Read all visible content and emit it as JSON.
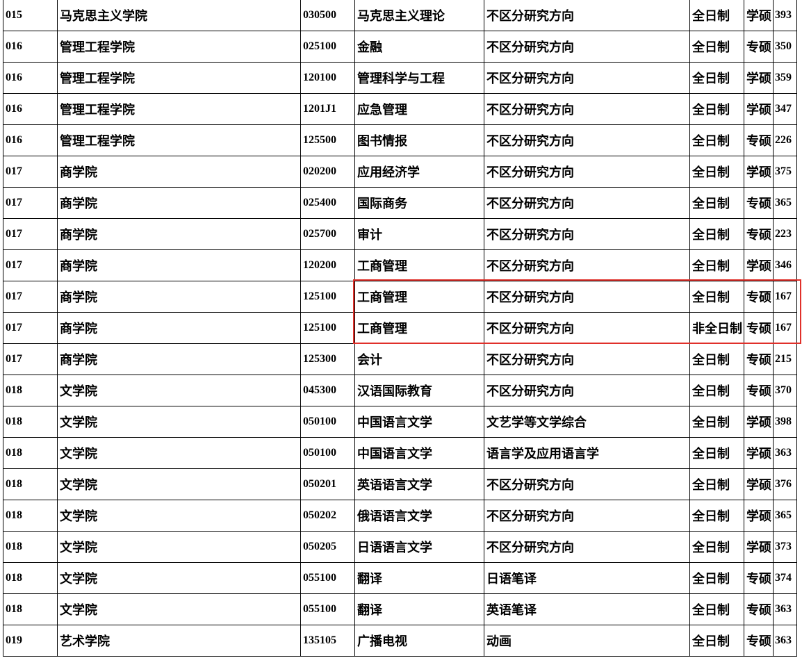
{
  "highlight_color": "#e0302a",
  "rows": [
    {
      "dept_code": "015",
      "dept_name": "马克思主义学院",
      "major_code": "030500",
      "major_name": "马克思主义理论",
      "direction": "不区分研究方向",
      "study_mode": "全日制",
      "degree_type": "学硕",
      "score": "393"
    },
    {
      "dept_code": "016",
      "dept_name": "管理工程学院",
      "major_code": "025100",
      "major_name": "金融",
      "direction": "不区分研究方向",
      "study_mode": "全日制",
      "degree_type": "专硕",
      "score": "350"
    },
    {
      "dept_code": "016",
      "dept_name": "管理工程学院",
      "major_code": "120100",
      "major_name": "管理科学与工程",
      "direction": "不区分研究方向",
      "study_mode": "全日制",
      "degree_type": "学硕",
      "score": "359"
    },
    {
      "dept_code": "016",
      "dept_name": "管理工程学院",
      "major_code": "1201J1",
      "major_name": "应急管理",
      "direction": "不区分研究方向",
      "study_mode": "全日制",
      "degree_type": "学硕",
      "score": "347"
    },
    {
      "dept_code": "016",
      "dept_name": "管理工程学院",
      "major_code": "125500",
      "major_name": "图书情报",
      "direction": "不区分研究方向",
      "study_mode": "全日制",
      "degree_type": "专硕",
      "score": "226"
    },
    {
      "dept_code": "017",
      "dept_name": "商学院",
      "major_code": "020200",
      "major_name": "应用经济学",
      "direction": "不区分研究方向",
      "study_mode": "全日制",
      "degree_type": "学硕",
      "score": "375"
    },
    {
      "dept_code": "017",
      "dept_name": "商学院",
      "major_code": "025400",
      "major_name": "国际商务",
      "direction": "不区分研究方向",
      "study_mode": "全日制",
      "degree_type": "专硕",
      "score": "365"
    },
    {
      "dept_code": "017",
      "dept_name": "商学院",
      "major_code": "025700",
      "major_name": "审计",
      "direction": "不区分研究方向",
      "study_mode": "全日制",
      "degree_type": "专硕",
      "score": "223"
    },
    {
      "dept_code": "017",
      "dept_name": "商学院",
      "major_code": "120200",
      "major_name": "工商管理",
      "direction": "不区分研究方向",
      "study_mode": "全日制",
      "degree_type": "学硕",
      "score": "346"
    },
    {
      "dept_code": "017",
      "dept_name": "商学院",
      "major_code": "125100",
      "major_name": "工商管理",
      "direction": "不区分研究方向",
      "study_mode": "全日制",
      "degree_type": "专硕",
      "score": "167"
    },
    {
      "dept_code": "017",
      "dept_name": "商学院",
      "major_code": "125100",
      "major_name": "工商管理",
      "direction": "不区分研究方向",
      "study_mode": "非全日制",
      "degree_type": "专硕",
      "score": "167"
    },
    {
      "dept_code": "017",
      "dept_name": "商学院",
      "major_code": "125300",
      "major_name": "会计",
      "direction": "不区分研究方向",
      "study_mode": "全日制",
      "degree_type": "专硕",
      "score": "215"
    },
    {
      "dept_code": "018",
      "dept_name": "文学院",
      "major_code": "045300",
      "major_name": "汉语国际教育",
      "direction": "不区分研究方向",
      "study_mode": "全日制",
      "degree_type": "专硕",
      "score": "370"
    },
    {
      "dept_code": "018",
      "dept_name": "文学院",
      "major_code": "050100",
      "major_name": "中国语言文学",
      "direction": "文艺学等文学综合",
      "study_mode": "全日制",
      "degree_type": "学硕",
      "score": "398"
    },
    {
      "dept_code": "018",
      "dept_name": "文学院",
      "major_code": "050100",
      "major_name": "中国语言文学",
      "direction": "语言学及应用语言学",
      "study_mode": "全日制",
      "degree_type": "学硕",
      "score": "363"
    },
    {
      "dept_code": "018",
      "dept_name": "文学院",
      "major_code": "050201",
      "major_name": "英语语言文学",
      "direction": "不区分研究方向",
      "study_mode": "全日制",
      "degree_type": "学硕",
      "score": "376"
    },
    {
      "dept_code": "018",
      "dept_name": "文学院",
      "major_code": "050202",
      "major_name": "俄语语言文学",
      "direction": "不区分研究方向",
      "study_mode": "全日制",
      "degree_type": "学硕",
      "score": "365"
    },
    {
      "dept_code": "018",
      "dept_name": "文学院",
      "major_code": "050205",
      "major_name": "日语语言文学",
      "direction": "不区分研究方向",
      "study_mode": "全日制",
      "degree_type": "学硕",
      "score": "373"
    },
    {
      "dept_code": "018",
      "dept_name": "文学院",
      "major_code": "055100",
      "major_name": "翻译",
      "direction": "日语笔译",
      "study_mode": "全日制",
      "degree_type": "专硕",
      "score": "374"
    },
    {
      "dept_code": "018",
      "dept_name": "文学院",
      "major_code": "055100",
      "major_name": "翻译",
      "direction": "英语笔译",
      "study_mode": "全日制",
      "degree_type": "专硕",
      "score": "363"
    },
    {
      "dept_code": "019",
      "dept_name": "艺术学院",
      "major_code": "135105",
      "major_name": "广播电视",
      "direction": "动画",
      "study_mode": "全日制",
      "degree_type": "专硕",
      "score": "363"
    }
  ]
}
